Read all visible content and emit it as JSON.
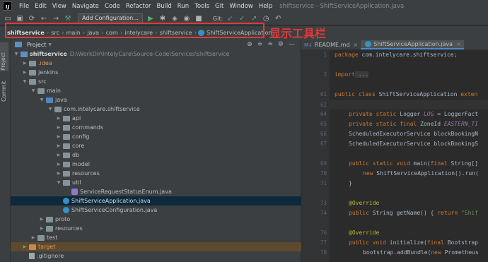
{
  "menubar": {
    "items": [
      "File",
      "Edit",
      "View",
      "Navigate",
      "Code",
      "Refactor",
      "Build",
      "Run",
      "Tools",
      "Git",
      "Window",
      "Help"
    ],
    "title": "shiftservice - ShiftServiceApplication.java"
  },
  "toolbar": {
    "run_config": "Add Configuration...",
    "git_label": "Git:"
  },
  "breadcrumb": {
    "items": [
      "shiftservice",
      "src",
      "main",
      "java",
      "com",
      "intelycare",
      "shiftservice",
      "ShiftServiceApplication"
    ]
  },
  "annotation": {
    "label": "显示工具栏"
  },
  "left_strip": {
    "project_tab": "Project",
    "commit_tab": "Commit"
  },
  "project_panel": {
    "title": "Project",
    "tree": [
      {
        "label": "shiftservice",
        "extra": "D:\\WorkDir\\IntelyCare\\Source-Code\\Services\\shiftservice"
      },
      {
        "label": ".idea"
      },
      {
        "label": "jenkins"
      },
      {
        "label": "src"
      },
      {
        "label": "main"
      },
      {
        "label": "java"
      },
      {
        "label": "com.intelycare.shiftservice"
      },
      {
        "label": "api"
      },
      {
        "label": "commands"
      },
      {
        "label": "config"
      },
      {
        "label": "core"
      },
      {
        "label": "db"
      },
      {
        "label": "model"
      },
      {
        "label": "resources"
      },
      {
        "label": "util"
      },
      {
        "label": "ServiceRequestStatusEnum.java"
      },
      {
        "label": "ShiftServiceApplication.java"
      },
      {
        "label": "ShiftServiceConfiguration.java"
      },
      {
        "label": "proto"
      },
      {
        "label": "resources"
      },
      {
        "label": "test"
      },
      {
        "label": "target"
      },
      {
        "label": ".gitignore"
      }
    ]
  },
  "editor": {
    "tabs": [
      "README.md",
      "ShiftServiceApplication.java"
    ],
    "line_numbers": [
      "1",
      "",
      "3",
      "",
      "61",
      "",
      "62",
      "",
      "64",
      "65",
      "66",
      "67",
      "",
      "69",
      "70",
      "71",
      "",
      "73",
      "74",
      "",
      "76",
      "77",
      "78"
    ],
    "code": {
      "l1a": "package",
      "l1b": " com.intelycare.shiftservice;",
      "l3a": "import",
      "l3b": " ...",
      "l61a": "public class",
      "l61b": " ShiftServiceApplication ",
      "l61c": "exten",
      "l64a": "private static",
      "l64b": " Logger ",
      "l64c": "LOG",
      "l64d": " = LoggerFact",
      "l65a": "private static final",
      "l65b": " ZoneId ",
      "l65c": "EASTERN_TI",
      "l66": "ScheduledExecutorService blockBookingN",
      "l67": "ScheduledExecutorService blockBookingS",
      "l69a": "public static void",
      "l69b": " main(",
      "l69c": "final",
      "l69d": " String[]",
      "l70a": "new",
      "l70b": " ShiftServiceApplication().run(",
      "l71": "}",
      "l73": "@Override",
      "l74a": "public",
      "l74b": " String getName() { ",
      "l74c": "return",
      "l74d": " \"Shif",
      "l76": "@Override",
      "l77a": "public void",
      "l77b": " initialize(",
      "l77c": "final",
      "l77d": " Bootstrap",
      "l78a": "bootstrap.addBundle(",
      "l78b": "new",
      "l78c": " Prometheus"
    }
  }
}
